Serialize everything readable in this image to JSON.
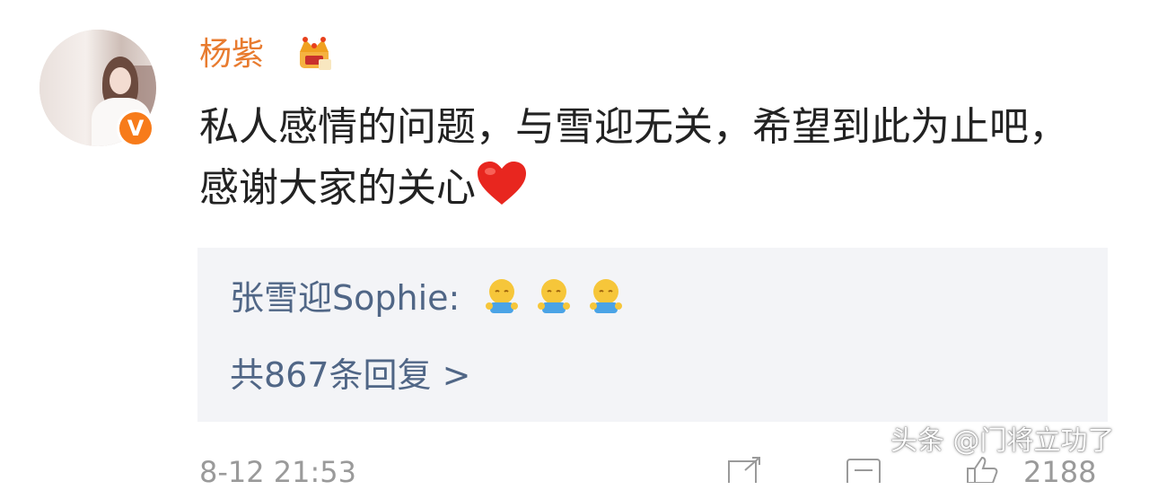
{
  "author": {
    "name": "杨紫",
    "verified_mark": "V"
  },
  "post": {
    "text": "私人感情的问题，与雪迎无关，希望到此为止吧，感谢大家的关心",
    "trailing_emoji": "heart-icon"
  },
  "replies": {
    "first_reply_prefix": "张雪迎Sophie: ",
    "reply_emoji": [
      "cry-emoji",
      "cry-emoji",
      "cry-emoji"
    ],
    "count_label": "共867条回复 >"
  },
  "footer": {
    "time": "8-12 21:53",
    "likes": "2188"
  },
  "watermark": "头条 @门将立功了",
  "colors": {
    "username": "#e87b2f",
    "link": "#506686",
    "reply_bg": "#f3f4f7",
    "badge": "#f77b1a"
  }
}
